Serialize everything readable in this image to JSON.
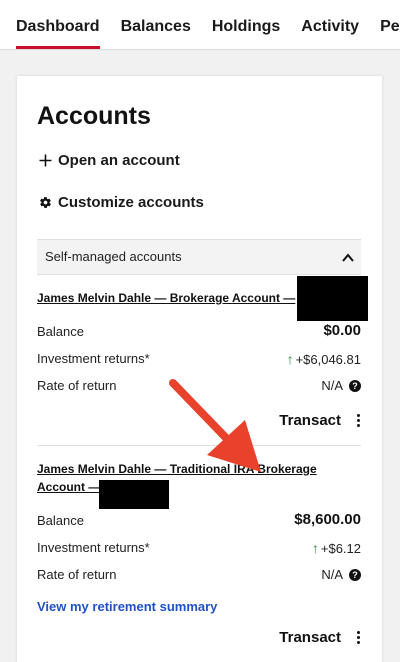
{
  "nav": {
    "tabs": [
      "Dashboard",
      "Balances",
      "Holdings",
      "Activity",
      "Performance"
    ],
    "active_tab": "Dashboard"
  },
  "accounts": {
    "title": "Accounts",
    "open_account_label": "Open an account",
    "customize_label": "Customize accounts",
    "section_label": "Self-managed accounts",
    "list": [
      {
        "name": "James Melvin Dahle — Brokerage Account —",
        "balance_label": "Balance",
        "balance": "$0.00",
        "returns_label": "Investment returns*",
        "returns": "+$6,046.81",
        "rate_label": "Rate of return",
        "rate": "N/A",
        "transact_label": "Transact"
      },
      {
        "name_line1": "James Melvin Dahle — Traditional IRA Brokerage",
        "name_line2": "Account —",
        "balance_label": "Balance",
        "balance": "$8,600.00",
        "returns_label": "Investment returns*",
        "returns": "+$6.12",
        "rate_label": "Rate of return",
        "rate": "N/A",
        "retirement_link": "View my retirement summary",
        "transact_label": "Transact"
      }
    ]
  },
  "colors": {
    "active_tab_underline": "#c8102e",
    "link": "#1f52c7",
    "positive": "#2e8b3a",
    "annotation_arrow": "#e8412c"
  },
  "icons": {
    "open_account": "plus-icon",
    "customize": "gear-icon",
    "section_toggle": "chevron-up-icon",
    "returns_trend": "arrow-up-icon",
    "help": "question-circle-icon",
    "more": "kebab-menu-icon"
  },
  "help_glyph": "?",
  "returns_arrow_glyph": "↑"
}
